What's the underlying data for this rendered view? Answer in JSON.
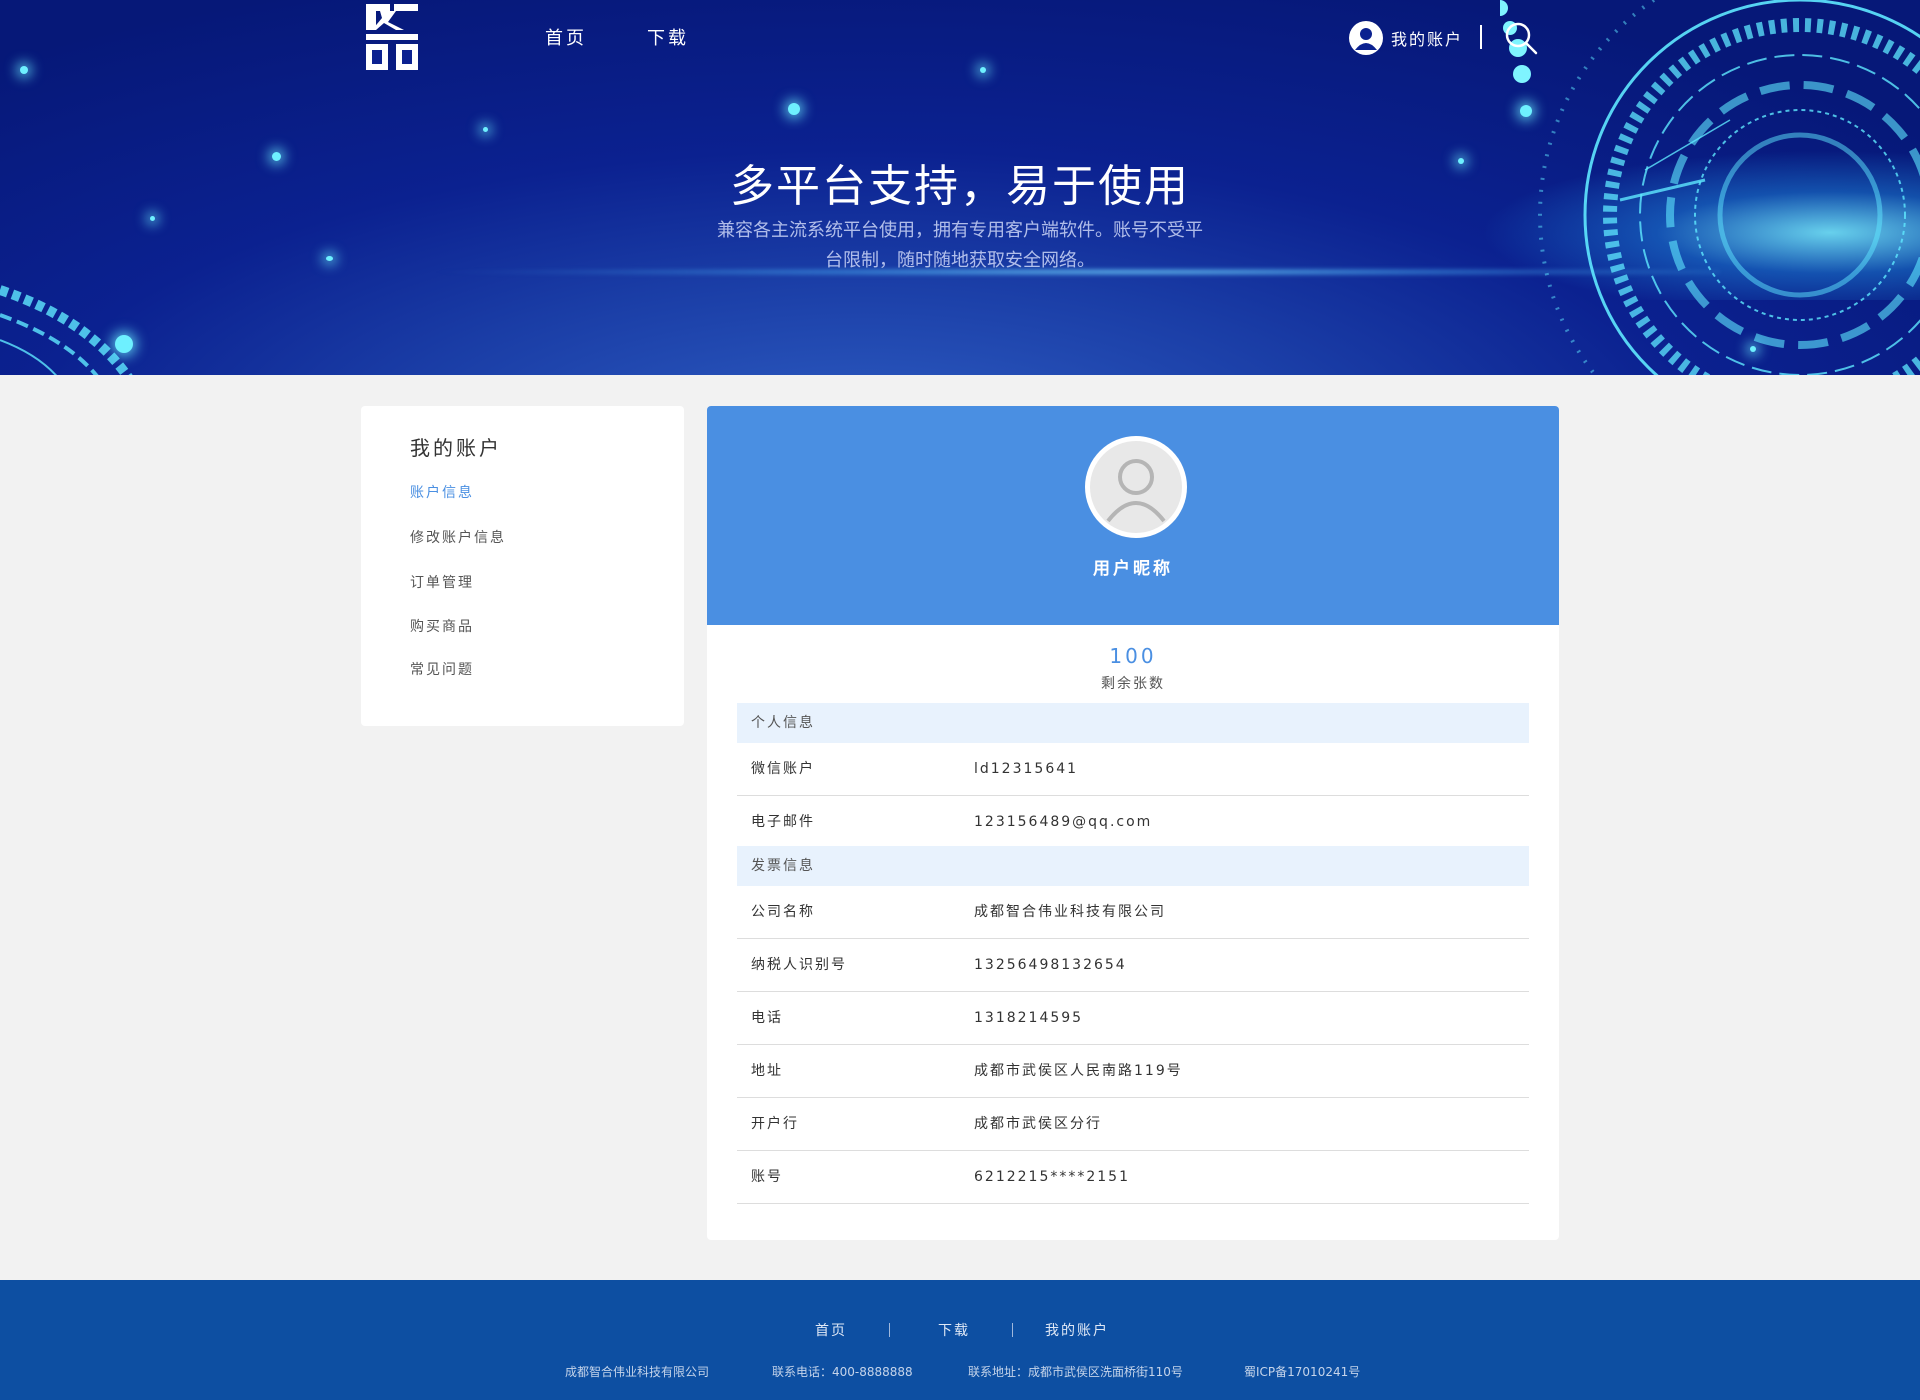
{
  "header": {
    "nav": [
      {
        "label": "首页"
      },
      {
        "label": "下载"
      }
    ],
    "account_label": "我的账户"
  },
  "hero": {
    "title": "多平台支持，易于使用",
    "subtitle_line1": "兼容各主流系统平台使用，拥有专用客户端软件。账号不受平",
    "subtitle_line2": "台限制，随时随地获取安全网络。"
  },
  "sidebar": {
    "title": "我的账户",
    "items": [
      {
        "label": "账户信息",
        "active": true
      },
      {
        "label": "修改账户信息",
        "active": false
      },
      {
        "label": "订单管理",
        "active": false
      },
      {
        "label": "购买商品",
        "active": false
      },
      {
        "label": "常见问题",
        "active": false
      }
    ]
  },
  "profile": {
    "nickname": "用户昵称",
    "balance_value": "100",
    "balance_label": "剩余张数"
  },
  "personal": {
    "heading": "个人信息",
    "rows": [
      {
        "key": "微信账户",
        "value": "ld12315641"
      },
      {
        "key": "电子邮件",
        "value": "123156489@qq.com"
      }
    ]
  },
  "invoice": {
    "heading": "发票信息",
    "rows": [
      {
        "key": "公司名称",
        "value": "成都智合伟业科技有限公司"
      },
      {
        "key": "纳税人识别号",
        "value": "13256498132654"
      },
      {
        "key": "电话",
        "value": "1318214595"
      },
      {
        "key": "地址",
        "value": "成都市武侯区人民南路119号"
      },
      {
        "key": "开户行",
        "value": "成都市武侯区分行"
      },
      {
        "key": "账号",
        "value": "6212215****2151"
      }
    ]
  },
  "footer": {
    "links": [
      {
        "label": "首页"
      },
      {
        "label": "下载"
      },
      {
        "label": "我的账户"
      }
    ],
    "company": "成都智合伟业科技有限公司",
    "phone": "联系电话：400-8888888",
    "address": "联系地址：成都市武侯区洗面桥街110号",
    "icp": "蜀ICP备17010241号"
  },
  "colors": {
    "accent": "#4a8fe2",
    "footer_bg": "#0d4fa2",
    "section_bg": "#e8f2fd"
  }
}
